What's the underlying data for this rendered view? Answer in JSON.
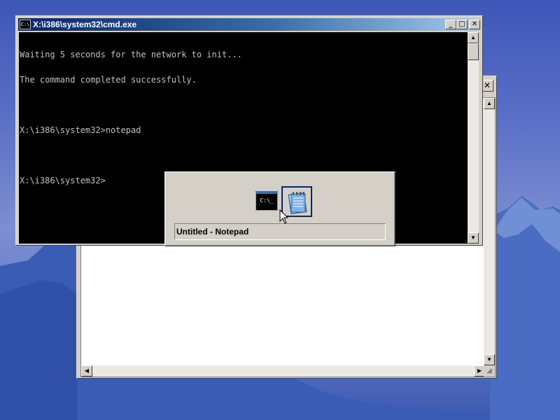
{
  "cmd_window": {
    "title": "X:\\i386\\system32\\cmd.exe",
    "title_icon": "C:\\",
    "buttons": {
      "minimize": "_",
      "maximize": "□",
      "close": "✕"
    },
    "console_lines": [
      "Waiting 5 seconds for the network to init...",
      "The command completed successfully.",
      "",
      "X:\\i386\\system32>notepad",
      "",
      "X:\\i386\\system32>"
    ],
    "scroll": {
      "up": "▲",
      "down": "▼"
    }
  },
  "notepad_window": {
    "close": "✕",
    "scroll": {
      "up": "▲",
      "down": "▼",
      "left": "◀",
      "right": "▶"
    }
  },
  "task_switcher": {
    "items": [
      {
        "icon": "console-icon",
        "glyph": "C:\\_"
      },
      {
        "icon": "notepad-icon"
      }
    ],
    "selected_label": "Untitled - Notepad"
  },
  "colors": {
    "title_active": "#0a246a",
    "console_bg": "#000000",
    "console_fg": "#c0c0c0",
    "window_face": "#d4d0c8"
  }
}
